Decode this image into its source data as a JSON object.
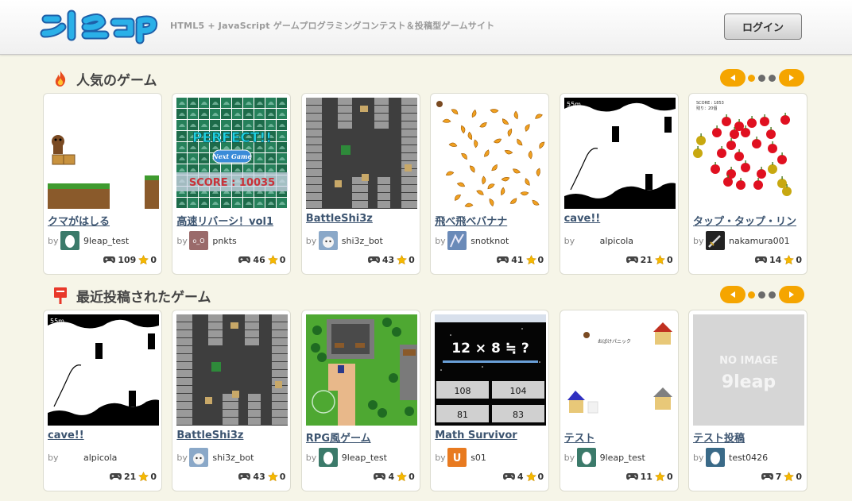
{
  "header": {
    "logo_text": "9leap",
    "tagline": "HTML5 + JavaScript ゲームプログラミングコンテスト＆投稿型ゲームサイト",
    "login_label": "ログイン"
  },
  "sections": [
    {
      "title": "人気のゲーム",
      "icon": "flame-icon",
      "games": [
        {
          "title": "クマがはしる",
          "author": "9leap_test",
          "plays": "109",
          "stars": "0",
          "thumb": "bear"
        },
        {
          "title": "高速リバーシ！vol1",
          "author": "pnkts",
          "author_avatar_text": "o_O",
          "plays": "46",
          "stars": "0",
          "thumb": "reversi",
          "thumb_text": {
            "perfect": "PERFECT!!",
            "next": "Next Game",
            "score": "SCORE : 10035"
          }
        },
        {
          "title": "BattleShi3z",
          "author": "shi3z_bot",
          "plays": "43",
          "stars": "0",
          "thumb": "battle"
        },
        {
          "title": "飛べ飛べバナナ",
          "author": "snotknot",
          "plays": "41",
          "stars": "0",
          "thumb": "banana"
        },
        {
          "title": "cave!!",
          "author": "alpicola",
          "plays": "21",
          "stars": "0",
          "thumb": "cave",
          "thumb_text": {
            "dist": "55m"
          }
        },
        {
          "title": "タップ・タップ・リン",
          "author": "nakamura001",
          "plays": "14",
          "stars": "0",
          "thumb": "apple",
          "thumb_text": {
            "score": "SCORE : 1853",
            "left": "残り：20個"
          }
        }
      ]
    },
    {
      "title": "最近投稿されたゲーム",
      "icon": "post-icon",
      "games": [
        {
          "title": "cave!!",
          "author": "alpicola",
          "plays": "21",
          "stars": "0",
          "thumb": "cave",
          "thumb_text": {
            "dist": "55m"
          }
        },
        {
          "title": "BattleShi3z",
          "author": "shi3z_bot",
          "plays": "43",
          "stars": "0",
          "thumb": "battle"
        },
        {
          "title": "RPG風ゲーム",
          "author": "9leap_test",
          "plays": "4",
          "stars": "0",
          "thumb": "rpg"
        },
        {
          "title": "Math Survivor",
          "author": "s01",
          "plays": "4",
          "stars": "0",
          "thumb": "math",
          "thumb_text": {
            "question": "12 × 8 ≒ ?",
            "a1": "108",
            "a2": "104",
            "a3": "81",
            "a4": "83"
          }
        },
        {
          "title": "テスト",
          "author": "9leap_test",
          "plays": "11",
          "stars": "0",
          "thumb": "ghost",
          "thumb_text": {
            "caption": "おばけパニック"
          }
        },
        {
          "title": "テスト投稿",
          "author": "test0426",
          "plays": "7",
          "stars": "0",
          "thumb": "noimage",
          "thumb_text": {
            "noimage": "NO IMAGE",
            "logo": "9leap"
          }
        }
      ]
    }
  ],
  "by_label": "by",
  "colors": {
    "accent": "#f5a500",
    "link": "#3c5470",
    "egg_bg": "#3b7a6a"
  }
}
